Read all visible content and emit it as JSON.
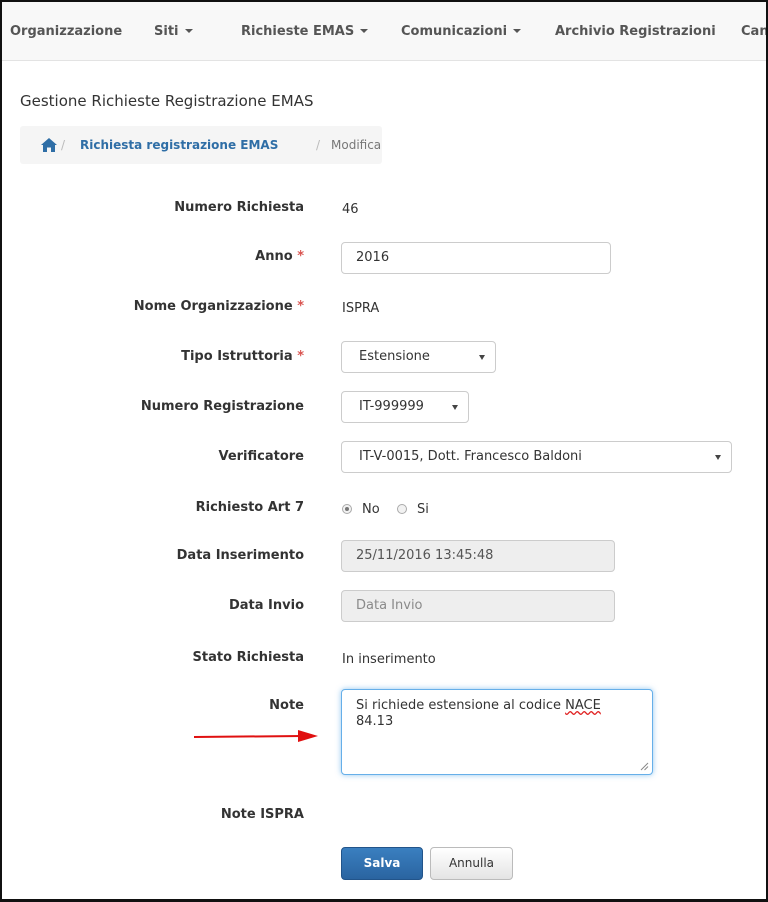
{
  "nav": {
    "items": [
      {
        "label": "Organizzazione",
        "dropdown": false
      },
      {
        "label": "Siti",
        "dropdown": true
      },
      {
        "label": "Richieste EMAS",
        "dropdown": true
      },
      {
        "label": "Comunicazioni",
        "dropdown": true
      },
      {
        "label": "Archivio Registrazioni",
        "dropdown": false
      },
      {
        "label": "Can",
        "dropdown": false
      }
    ]
  },
  "page": {
    "title": "Gestione Richieste Registrazione EMAS"
  },
  "breadcrumb": {
    "home_icon": "home-icon",
    "separator": "/",
    "link": "Richiesta registrazione EMAS",
    "active": "Modifica"
  },
  "form": {
    "numero_richiesta": {
      "label": "Numero Richiesta",
      "value": "46"
    },
    "anno": {
      "label": "Anno",
      "required_mark": "*",
      "value": "2016"
    },
    "nome_organizzazione": {
      "label": "Nome Organizzazione",
      "required_mark": "*",
      "value": "ISPRA"
    },
    "tipo_istruttoria": {
      "label": "Tipo Istruttoria",
      "required_mark": "*",
      "selected": "Estensione"
    },
    "numero_registrazione": {
      "label": "Numero Registrazione",
      "selected": "IT-999999"
    },
    "verificatore": {
      "label": "Verificatore",
      "selected": "IT-V-0015, Dott. Francesco Baldoni"
    },
    "richiesto_art7": {
      "label": "Richiesto Art 7",
      "options": [
        {
          "label": "No",
          "checked": true
        },
        {
          "label": "Si",
          "checked": false
        }
      ]
    },
    "data_inserimento": {
      "label": "Data Inserimento",
      "value": "25/11/2016 13:45:48"
    },
    "data_invio": {
      "label": "Data Invio",
      "placeholder": "Data Invio"
    },
    "stato_richiesta": {
      "label": "Stato Richiesta",
      "value": "In inserimento"
    },
    "note": {
      "label": "Note",
      "line1_prefix": "Si richiede estensione al codice ",
      "line1_misspelled": "NACE",
      "line2": "84.13"
    },
    "note_ispra": {
      "label": "Note ISPRA"
    }
  },
  "buttons": {
    "save": "Salva",
    "cancel": "Annulla"
  },
  "colors": {
    "primary": "#2d6ca2",
    "required": "#d9534f",
    "arrow": "#e01010",
    "focus": "#66afe9"
  }
}
